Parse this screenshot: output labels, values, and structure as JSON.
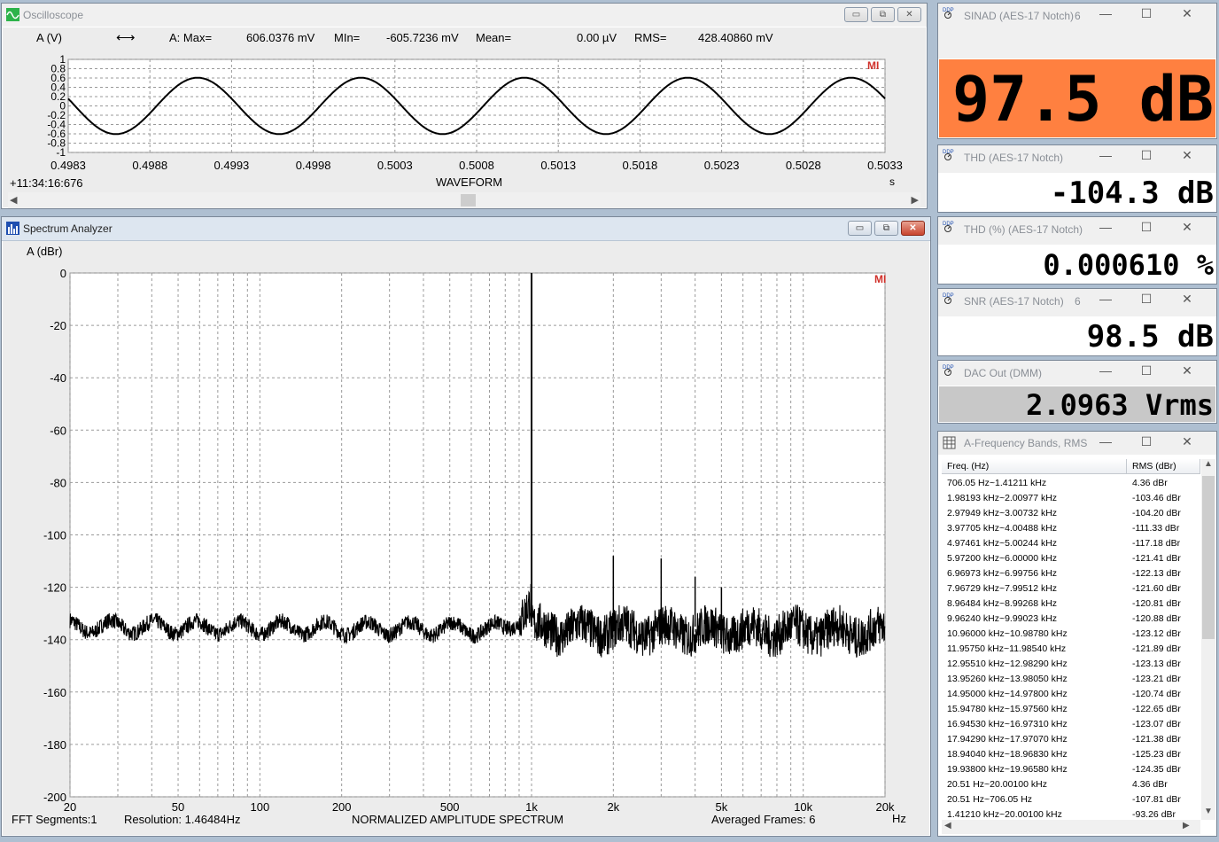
{
  "oscilloscope": {
    "title": "Oscilloscope",
    "channel": "A (V)",
    "max_label": "A: Max=",
    "max_value": "606.0376 mV",
    "min_label": "MIn=",
    "min_value": "-605.7236 mV",
    "mean_label": "Mean=",
    "mean_value": "0.00  µV",
    "rms_label": "RMS=",
    "rms_value": "428.40860 mV",
    "timestamp": "+11:34:16:676",
    "xlabel": "WAVEFORM",
    "xunit": "s",
    "logo": "MI",
    "y_ticks": [
      "1",
      "0.8",
      "0.6",
      "0.4",
      "0.2",
      "0",
      "-0.2",
      "-0.4",
      "-0.6",
      "-0.8",
      "-1"
    ],
    "x_ticks": [
      "0.4983",
      "0.4988",
      "0.4993",
      "0.4998",
      "0.5003",
      "0.5008",
      "0.5013",
      "0.5018",
      "0.5023",
      "0.5028",
      "0.5033"
    ]
  },
  "spectrum": {
    "title": "Spectrum Analyzer",
    "ylabel": "A (dBr)",
    "xunit": "Hz",
    "logo": "MI",
    "y_ticks": [
      "0",
      "-20",
      "-40",
      "-60",
      "-80",
      "-100",
      "-120",
      "-140",
      "-160",
      "-180",
      "-200"
    ],
    "x_ticks": [
      "20",
      "50",
      "100",
      "200",
      "500",
      "1k",
      "2k",
      "5k",
      "10k",
      "20k"
    ],
    "footer_segments": "FFT Segments:1",
    "footer_resolution": "Resolution: 1.46484Hz",
    "footer_title": "NORMALIZED AMPLITUDE SPECTRUM",
    "footer_frames": "Averaged Frames: 6"
  },
  "meters": [
    {
      "title": "SINAD (AES-17 Notch)",
      "count": "6",
      "value": "97.5 dB",
      "bg": "#ff8040"
    },
    {
      "title": "THD (AES-17 Notch)",
      "count": "",
      "value": "-104.3 dB",
      "bg": "#ffffff"
    },
    {
      "title": "THD (%) (AES-17 Notch)",
      "count": "",
      "value": "0.000610 %",
      "bg": "#ffffff"
    },
    {
      "title": "SNR (AES-17 Notch)",
      "count": "6",
      "value": "98.5 dB",
      "bg": "#ffffff"
    },
    {
      "title": "DAC Out (DMM)",
      "count": "",
      "value": "2.0963 Vrms",
      "bg": "#c8c8c8"
    }
  ],
  "bands": {
    "title": "A-Frequency Bands, RMS",
    "col_freq": "Freq. (Hz)",
    "col_rms": "RMS (dBr)",
    "rows": [
      [
        "706.05 Hz~1.41211 kHz",
        "4.36 dBr"
      ],
      [
        "1.98193 kHz~2.00977 kHz",
        "-103.46 dBr"
      ],
      [
        "2.97949 kHz~3.00732 kHz",
        "-104.20 dBr"
      ],
      [
        "3.97705 kHz~4.00488 kHz",
        "-111.33 dBr"
      ],
      [
        "4.97461 kHz~5.00244 kHz",
        "-117.18 dBr"
      ],
      [
        "5.97200 kHz~6.00000 kHz",
        "-121.41 dBr"
      ],
      [
        "6.96973 kHz~6.99756 kHz",
        "-122.13 dBr"
      ],
      [
        "7.96729 kHz~7.99512 kHz",
        "-121.60 dBr"
      ],
      [
        "8.96484 kHz~8.99268 kHz",
        "-120.81 dBr"
      ],
      [
        "9.96240 kHz~9.99023 kHz",
        "-120.88 dBr"
      ],
      [
        "10.96000 kHz~10.98780 kHz",
        "-123.12 dBr"
      ],
      [
        "11.95750 kHz~11.98540 kHz",
        "-121.89 dBr"
      ],
      [
        "12.95510 kHz~12.98290 kHz",
        "-123.13 dBr"
      ],
      [
        "13.95260 kHz~13.98050 kHz",
        "-123.21 dBr"
      ],
      [
        "14.95000 kHz~14.97800 kHz",
        "-120.74 dBr"
      ],
      [
        "15.94780 kHz~15.97560 kHz",
        "-122.65 dBr"
      ],
      [
        "16.94530 kHz~16.97310 kHz",
        "-123.07 dBr"
      ],
      [
        "17.94290 kHz~17.97070 kHz",
        "-121.38 dBr"
      ],
      [
        "18.94040 kHz~18.96830 kHz",
        "-125.23 dBr"
      ],
      [
        "19.93800 kHz~19.96580 kHz",
        "-124.35 dBr"
      ],
      [
        "20.51 Hz~20.00100 kHz",
        "4.36 dBr"
      ],
      [
        "20.51 Hz~706.05 Hz",
        "-107.81 dBr"
      ],
      [
        "1.41210 kHz~20.00100 kHz",
        "-93.26 dBr"
      ]
    ]
  },
  "chart_data": [
    {
      "type": "line",
      "name": "oscilloscope",
      "title": "WAVEFORM",
      "xlabel": "WAVEFORM",
      "ylabel": "A (V)",
      "xlim": [
        0.4983,
        0.5033
      ],
      "ylim": [
        -1,
        1
      ],
      "grid": true,
      "series": [
        {
          "amplitude": 0.606,
          "frequency_hz": 1000,
          "phase_at_xmin_deg": 165
        }
      ]
    },
    {
      "type": "line",
      "name": "spectrum",
      "title": "NORMALIZED AMPLITUDE SPECTRUM",
      "xlabel": "Hz",
      "ylabel": "A (dBr)",
      "xscale": "log",
      "xlim": [
        20,
        20000
      ],
      "ylim": [
        -200,
        0
      ],
      "grid": true,
      "noise_floor_low_db": -135,
      "noise_floor_high_db": -137,
      "peaks": [
        {
          "x": 1000,
          "y": 0
        },
        {
          "x": 2000,
          "y": -108
        },
        {
          "x": 3000,
          "y": -109
        },
        {
          "x": 4000,
          "y": -116
        },
        {
          "x": 5000,
          "y": -120
        }
      ]
    }
  ]
}
